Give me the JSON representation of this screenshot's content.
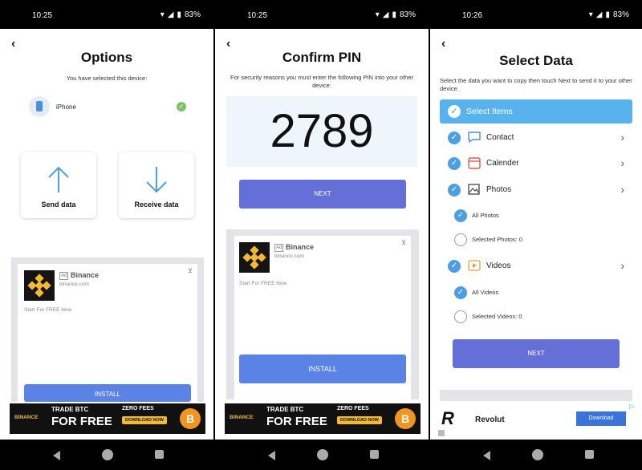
{
  "status": {
    "p1_time": "10:25",
    "p2_time": "10:25",
    "p3_time": "10:26",
    "battery": "83%"
  },
  "options": {
    "title": "Options",
    "subtitle": "You have selected this device:",
    "device": "iPhone",
    "send": "Send data",
    "receive": "Receive data"
  },
  "ad_binance": {
    "tag": "Ad",
    "name": "Binance",
    "domain": "binance.com",
    "text": "Start For FREE Now",
    "install": "INSTALL"
  },
  "banner": {
    "brand": "BINANCE",
    "trade": "TRADE BTC",
    "free": "FOR FREE",
    "zero": "ZERO FEES",
    "download": "DOWNLOAD NOW",
    "coin": "B"
  },
  "confirm": {
    "title": "Confirm PIN",
    "subtitle": "For security reasons you must enter the following PIN into your other device:",
    "pin": "2789",
    "next": "NEXT"
  },
  "select": {
    "title": "Select Data",
    "subtitle": "Select the data you want to copy then touch Next to send it to your other device.",
    "header": "Select Items",
    "contact": "Contact",
    "calender": "Calender",
    "photos": "Photos",
    "all_photos": "All Photos",
    "selected_photos": "Selected Photos: 0",
    "videos": "Videos",
    "all_videos": "All Videos",
    "selected_videos": "Selected Videos: 0",
    "next": "NEXT"
  },
  "revolut": {
    "logo": "R",
    "name": "Revolut",
    "download": "Download"
  },
  "colors": {
    "accent_blue": "#58b2ee",
    "button_purple": "#6470d8",
    "button_blue": "#5b83e6",
    "check_green": "#7cc36a"
  }
}
